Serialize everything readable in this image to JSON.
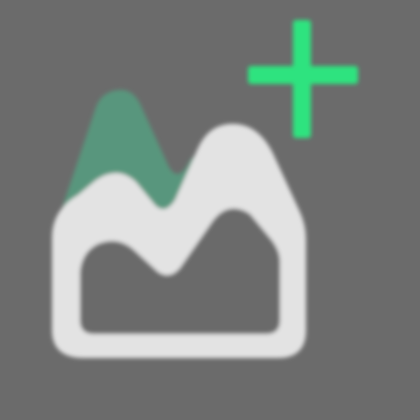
{
  "icon": {
    "name": "add-area-chart-icon",
    "colors": {
      "background": "#6b6b6b",
      "chart_fill": "#58967d",
      "chart_outline": "#e3e3e3",
      "plus": "#2ee37f"
    }
  }
}
